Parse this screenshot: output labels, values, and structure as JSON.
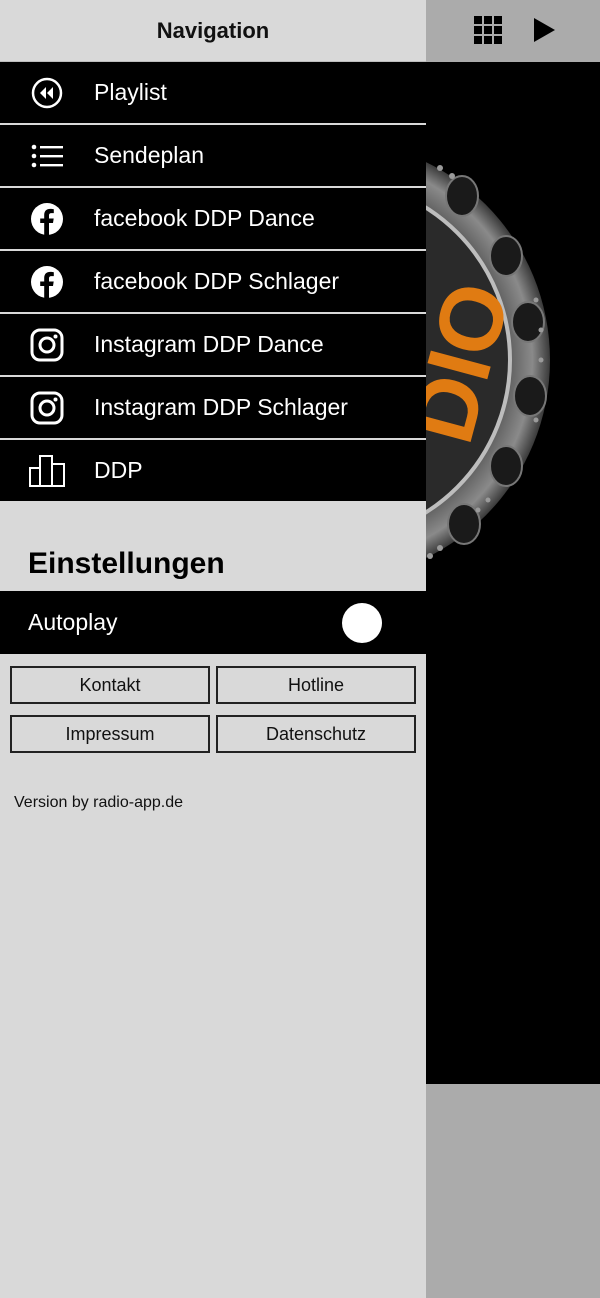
{
  "drawer": {
    "title": "Navigation",
    "items": [
      {
        "label": "Playlist",
        "icon": "rewind-circle-icon"
      },
      {
        "label": "Sendeplan",
        "icon": "list-icon"
      },
      {
        "label": "facebook DDP Dance",
        "icon": "facebook-icon"
      },
      {
        "label": "facebook DDP Schlager",
        "icon": "facebook-icon"
      },
      {
        "label": "Instagram DDP Dance",
        "icon": "instagram-icon"
      },
      {
        "label": "Instagram DDP Schlager",
        "icon": "instagram-icon"
      },
      {
        "label": "DDP",
        "icon": "buildings-icon"
      }
    ]
  },
  "settings": {
    "title": "Einstellungen",
    "autoplay_label": "Autoplay",
    "autoplay_on": false
  },
  "buttons": {
    "kontakt": "Kontakt",
    "hotline": "Hotline",
    "impressum": "Impressum",
    "datenschutz": "Datenschutz"
  },
  "footer": {
    "version": "Version by radio-app.de"
  },
  "background": {
    "logo_text": "DIO",
    "accent_color": "#e07b12"
  }
}
